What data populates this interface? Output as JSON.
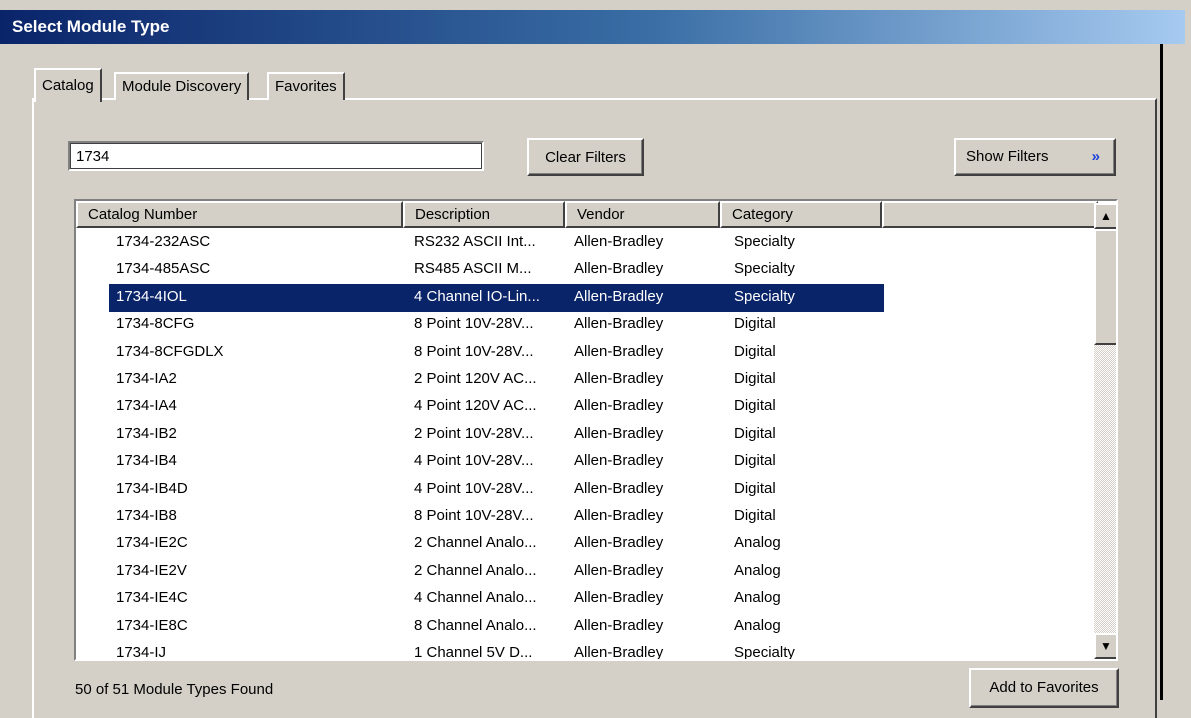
{
  "window": {
    "title": "Select Module Type"
  },
  "tabs": [
    {
      "label": "Catalog",
      "active": true
    },
    {
      "label": "Module Discovery",
      "active": false
    },
    {
      "label": "Favorites",
      "active": false
    }
  ],
  "search": {
    "value": "1734"
  },
  "buttons": {
    "clear_filters": "Clear Filters",
    "show_filters": "Show Filters",
    "show_filters_icon": "double-chevron-down-icon",
    "add_to_favorites": "Add to Favorites"
  },
  "table": {
    "columns": [
      "Catalog Number",
      "Description",
      "Vendor",
      "Category"
    ],
    "selected_index": 2,
    "rows": [
      {
        "catalog": "1734-232ASC",
        "description": "RS232 ASCII Int...",
        "vendor": "Allen-Bradley",
        "category": "Specialty"
      },
      {
        "catalog": "1734-485ASC",
        "description": "RS485 ASCII M...",
        "vendor": "Allen-Bradley",
        "category": "Specialty"
      },
      {
        "catalog": "1734-4IOL",
        "description": "4 Channel IO-Lin...",
        "vendor": "Allen-Bradley",
        "category": "Specialty"
      },
      {
        "catalog": "1734-8CFG",
        "description": "8 Point 10V-28V...",
        "vendor": "Allen-Bradley",
        "category": "Digital"
      },
      {
        "catalog": "1734-8CFGDLX",
        "description": "8 Point 10V-28V...",
        "vendor": "Allen-Bradley",
        "category": "Digital"
      },
      {
        "catalog": "1734-IA2",
        "description": "2 Point 120V AC...",
        "vendor": "Allen-Bradley",
        "category": "Digital"
      },
      {
        "catalog": "1734-IA4",
        "description": "4 Point 120V AC...",
        "vendor": "Allen-Bradley",
        "category": "Digital"
      },
      {
        "catalog": "1734-IB2",
        "description": "2 Point 10V-28V...",
        "vendor": "Allen-Bradley",
        "category": "Digital"
      },
      {
        "catalog": "1734-IB4",
        "description": "4 Point 10V-28V...",
        "vendor": "Allen-Bradley",
        "category": "Digital"
      },
      {
        "catalog": "1734-IB4D",
        "description": "4 Point 10V-28V...",
        "vendor": "Allen-Bradley",
        "category": "Digital"
      },
      {
        "catalog": "1734-IB8",
        "description": "8 Point 10V-28V...",
        "vendor": "Allen-Bradley",
        "category": "Digital"
      },
      {
        "catalog": "1734-IE2C",
        "description": "2 Channel Analo...",
        "vendor": "Allen-Bradley",
        "category": "Analog"
      },
      {
        "catalog": "1734-IE2V",
        "description": "2 Channel Analo...",
        "vendor": "Allen-Bradley",
        "category": "Analog"
      },
      {
        "catalog": "1734-IE4C",
        "description": "4 Channel Analo...",
        "vendor": "Allen-Bradley",
        "category": "Analog"
      },
      {
        "catalog": "1734-IE8C",
        "description": "8 Channel Analo...",
        "vendor": "Allen-Bradley",
        "category": "Analog"
      },
      {
        "catalog": "1734-IJ",
        "description": "1 Channel 5V D...",
        "vendor": "Allen-Bradley",
        "category": "Specialty"
      }
    ]
  },
  "status": {
    "text": "50 of 51 Module Types Found"
  },
  "colors": {
    "selection": "#0a246a",
    "titlebar_start": "#0a246a",
    "titlebar_end": "#a6caf0",
    "chevron": "#1a3fd8"
  }
}
